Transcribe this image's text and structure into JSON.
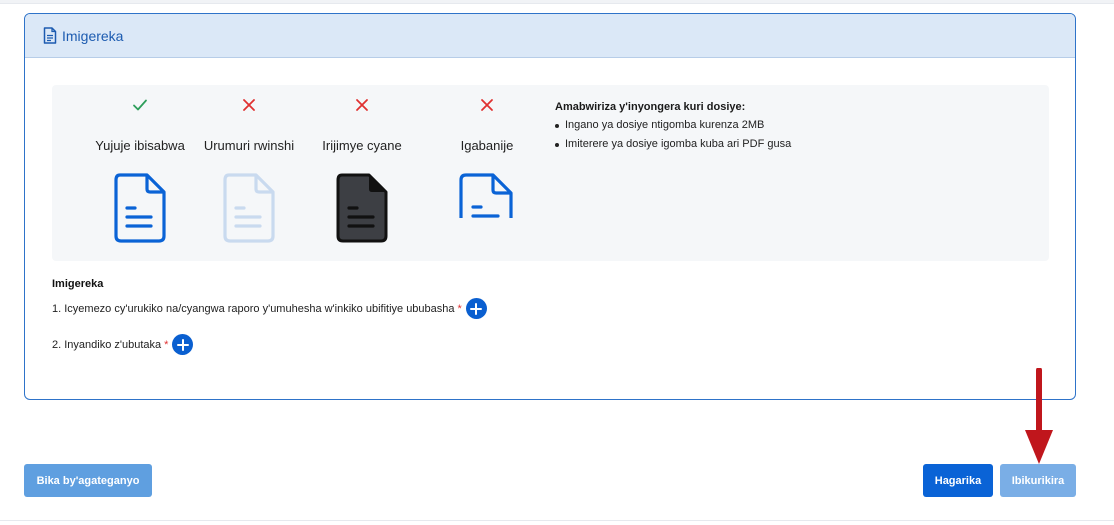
{
  "card": {
    "title": "Imigereka",
    "title_icon": "file-text-icon"
  },
  "guide": {
    "examples": [
      {
        "caption": "Yujuje ibisabwa",
        "status": "check-icon",
        "status_color": "#2e9e5b",
        "doc_style": "outline-blue"
      },
      {
        "caption": "Urumuri rwinshi",
        "status": "cross-icon",
        "status_color": "#e03131",
        "doc_style": "faded-blue"
      },
      {
        "caption": "Irijimye cyane",
        "status": "cross-icon",
        "status_color": "#e03131",
        "doc_style": "dark-filled"
      },
      {
        "caption": "Igabanije",
        "status": "cross-icon",
        "status_color": "#e03131",
        "doc_style": "cropped-blue"
      }
    ],
    "rules_title": "Amabwiriza y'inyongera kuri dosiye:",
    "rules": [
      "Ingano ya dosiye ntigomba kurenza 2MB",
      "Imiterere ya dosiye igomba kuba ari PDF gusa"
    ]
  },
  "attachments": {
    "title": "Imigereka",
    "items": [
      {
        "label": "1. Icyemezo cy'urukiko na/cyangwa raporo y'umuhesha w'inkiko ubifitiye ububasha",
        "required_mark": "*",
        "add_icon": "plus-circle-icon"
      },
      {
        "label": "2. Inyandiko z'ubutaka",
        "required_mark": "*",
        "add_icon": "plus-circle-icon"
      }
    ]
  },
  "footer": {
    "save_draft_label": "Bika by'agateganyo",
    "cancel_label": "Hagarika",
    "submit_label": "Ibikurikira"
  },
  "annotation": {
    "arrow_icon": "red-arrow-down-icon",
    "arrow_color": "#c0161c"
  },
  "colors": {
    "primary": "#0a63d6",
    "card_border": "#2e73c9",
    "header_bg": "#dbe8f7",
    "required": "#e03131"
  }
}
